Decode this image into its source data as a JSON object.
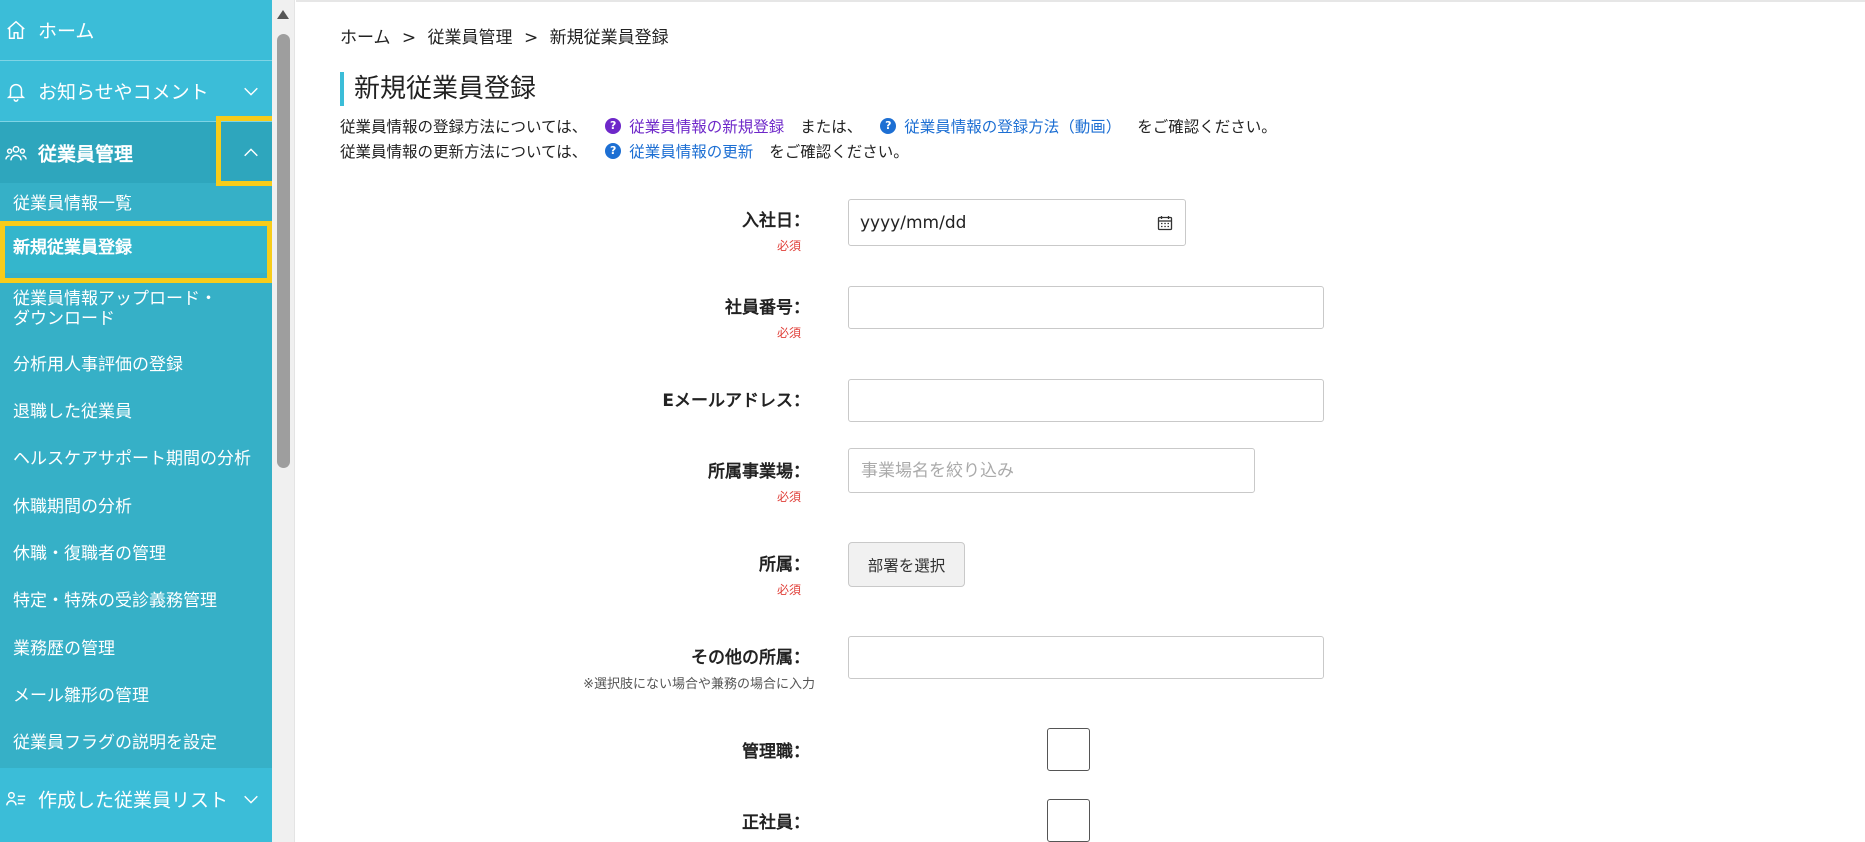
{
  "sidebar": {
    "home": "ホーム",
    "notices": "お知らせやコメント",
    "employee_mgmt": "従業員管理",
    "submenu": [
      "従業員情報一覧",
      "新規従業員登録",
      "従業員情報アップロード・",
      "ダウンロード",
      "分析用人事評価の登録",
      "退職した従業員",
      "ヘルスケアサポート期間の分析",
      "休職期間の分析",
      "休職・復職者の管理",
      "特定・特殊の受診義務管理",
      "業務歴の管理",
      "メール雛形の管理",
      "従業員フラグの説明を設定"
    ],
    "created_lists": "作成した従業員リスト"
  },
  "breadcrumb": {
    "items": [
      "ホーム",
      "従業員管理",
      "新規従業員登録"
    ],
    "sep": ">"
  },
  "page": {
    "title": "新規従業員登録",
    "info1_prefix": "従業員情報の登録方法については、",
    "info1_link1": "従業員情報の新規登録",
    "info1_mid": "または、",
    "info1_link2": "従業員情報の登録方法（動画）",
    "info1_suffix": "をご確認ください。",
    "info2_prefix": "従業員情報の更新方法については、",
    "info2_link": "従業員情報の更新",
    "info2_suffix": "をご確認ください。",
    "q_mark": "?"
  },
  "form": {
    "required": "必須",
    "hire_date_label": "入社日：",
    "hire_date_value": "yyyy/mm/dd",
    "emp_no_label": "社員番号：",
    "email_label": "Eメールアドレス：",
    "site_label": "所属事業場：",
    "site_placeholder": "事業場名を絞り込み",
    "dept_label": "所属：",
    "dept_button": "部署を選択",
    "other_dept_label": "その他の所属：",
    "other_dept_note": "※選択肢にない場合や兼務の場合に入力",
    "manager_label": "管理職：",
    "fulltime_label": "正社員："
  },
  "colors": {
    "sidebar": "#3bbdd8",
    "highlight": "#f7cc1a",
    "required": "#e0403a",
    "link_purple": "#6e28c9",
    "link_blue": "#1d6fd3"
  }
}
